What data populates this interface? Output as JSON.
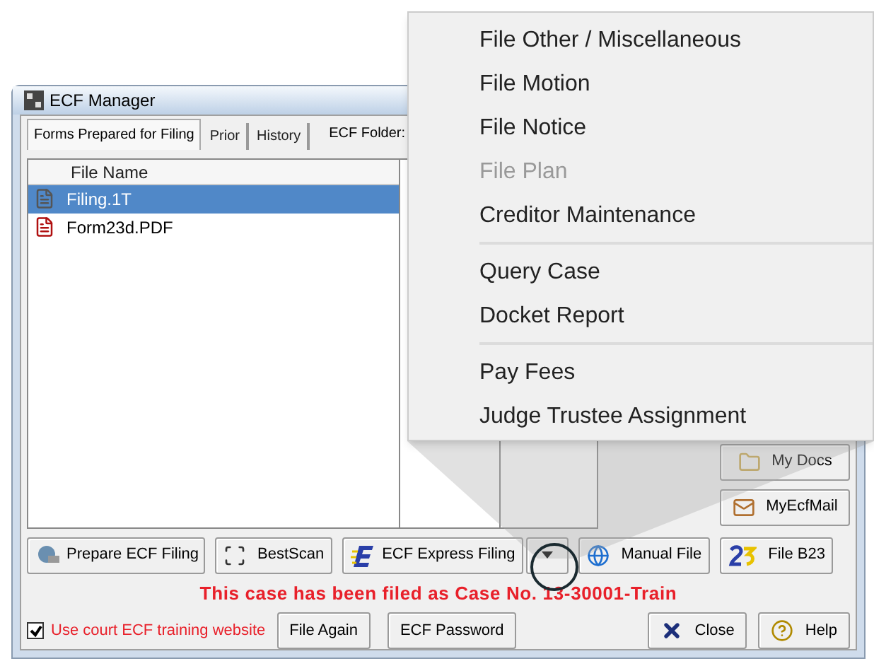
{
  "window": {
    "title": "ECF Manager"
  },
  "tabs": [
    {
      "label": "Forms Prepared for Filing",
      "selected": true
    },
    {
      "label": "Prior",
      "selected": false
    },
    {
      "label": "History",
      "selected": false
    }
  ],
  "folder_label": "ECF Folder:",
  "file_list": {
    "column": "File Name",
    "rows": [
      {
        "name": "Filing.1T",
        "kind": "text",
        "selected": true
      },
      {
        "name": "Form23d.PDF",
        "kind": "pdf",
        "selected": false
      }
    ]
  },
  "side_buttons": [
    {
      "label": "My Docs",
      "kind": "folder"
    },
    {
      "label": "MyEcfMail",
      "kind": "mail"
    }
  ],
  "action_buttons": [
    {
      "label": "Prepare ECF Filing",
      "kind": "prepare"
    },
    {
      "label": "BestScan",
      "kind": "scan"
    },
    {
      "label": "ECF Express Filing",
      "kind": "express"
    },
    {
      "label": "Manual File",
      "kind": "manual"
    },
    {
      "label": "File B23",
      "kind": "b23"
    }
  ],
  "message": "This case has been filed as Case No. 13-30001-Train",
  "training_checkbox": {
    "label": "Use court ECF training website",
    "checked": true
  },
  "bottom_buttons": [
    {
      "label": "File Again",
      "kind": "plain"
    },
    {
      "label": "ECF Password",
      "kind": "plain"
    },
    {
      "label": "Close",
      "kind": "close"
    },
    {
      "label": "Help",
      "kind": "help"
    }
  ],
  "menu": {
    "groups": [
      {
        "items": [
          {
            "label": "File Other / Miscellaneous",
            "disabled": false
          },
          {
            "label": "File Motion",
            "disabled": false
          },
          {
            "label": "File Notice",
            "disabled": false
          },
          {
            "label": "File Plan",
            "disabled": true
          },
          {
            "label": "Creditor Maintenance",
            "disabled": false
          }
        ]
      },
      {
        "items": [
          {
            "label": "Query Case",
            "disabled": false
          },
          {
            "label": "Docket Report",
            "disabled": false
          }
        ]
      },
      {
        "items": [
          {
            "label": "Pay Fees",
            "disabled": false
          },
          {
            "label": "Judge Trustee Assignment",
            "disabled": false
          }
        ]
      }
    ]
  }
}
